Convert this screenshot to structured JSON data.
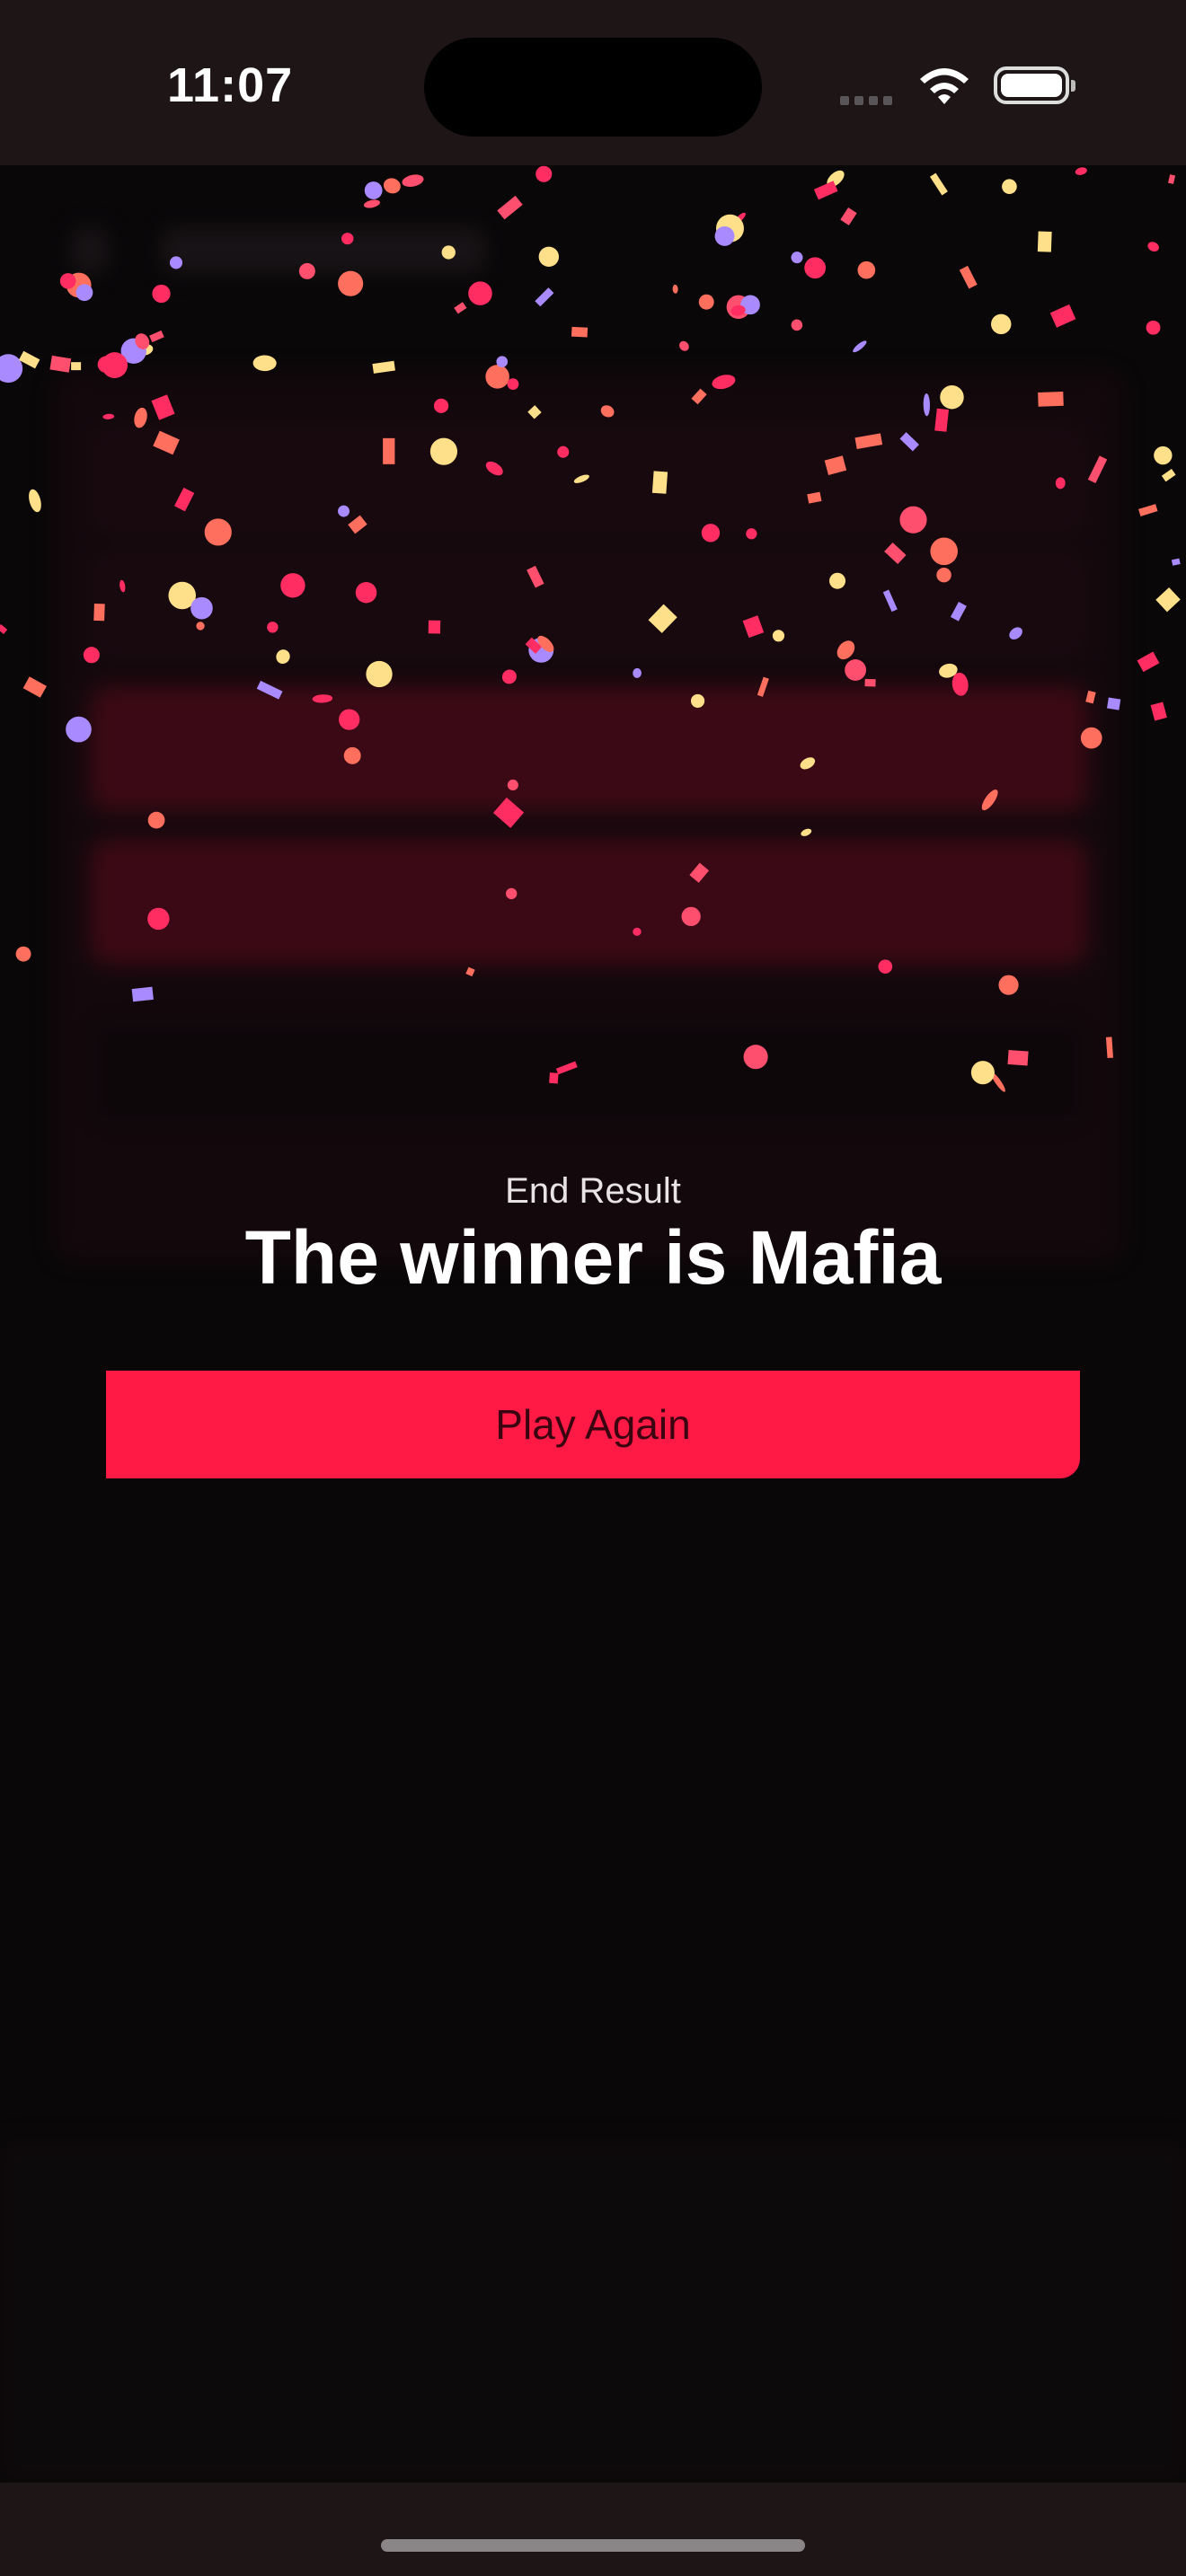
{
  "status_bar": {
    "time": "11:07"
  },
  "result": {
    "label": "End Result",
    "title": "The winner is Mafia"
  },
  "actions": {
    "play_again": "Play Again"
  },
  "colors": {
    "accent": "#ff1a46",
    "background": "#0c090b",
    "status_bar": "#1e1517",
    "confetti": [
      "#ff2d62",
      "#ffe08a",
      "#a98bff",
      "#ff6f5e",
      "#ff4f6e"
    ]
  }
}
